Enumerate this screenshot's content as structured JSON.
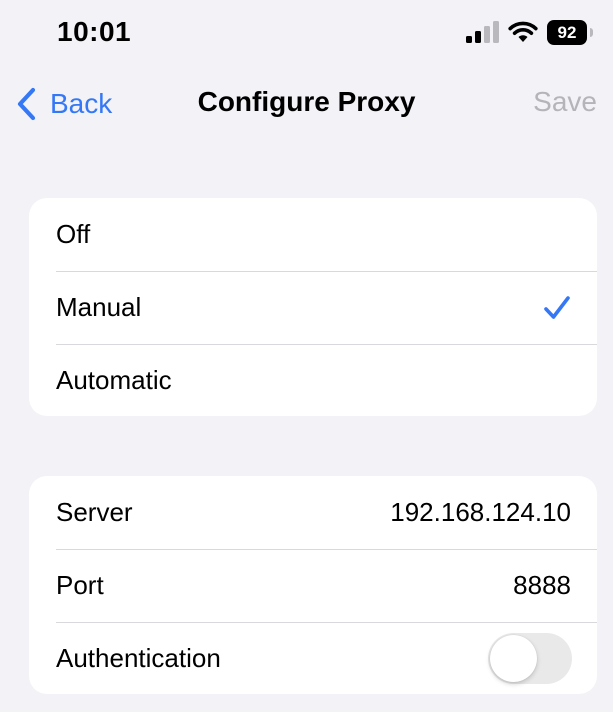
{
  "status_bar": {
    "time": "10:01",
    "battery_level": "92",
    "signal_icon": "cellular-signal-icon",
    "wifi_icon": "wifi-icon"
  },
  "nav": {
    "back_label": "Back",
    "title": "Configure Proxy",
    "save_label": "Save",
    "accent_color": "#3478f6",
    "disabled_color": "#b4b4b9"
  },
  "proxy_mode": {
    "options": [
      {
        "label": "Off",
        "selected": false
      },
      {
        "label": "Manual",
        "selected": true
      },
      {
        "label": "Automatic",
        "selected": false
      }
    ]
  },
  "details": {
    "server_label": "Server",
    "server_value": "192.168.124.10",
    "port_label": "Port",
    "port_value": "8888",
    "authentication_label": "Authentication",
    "authentication_on": false
  }
}
